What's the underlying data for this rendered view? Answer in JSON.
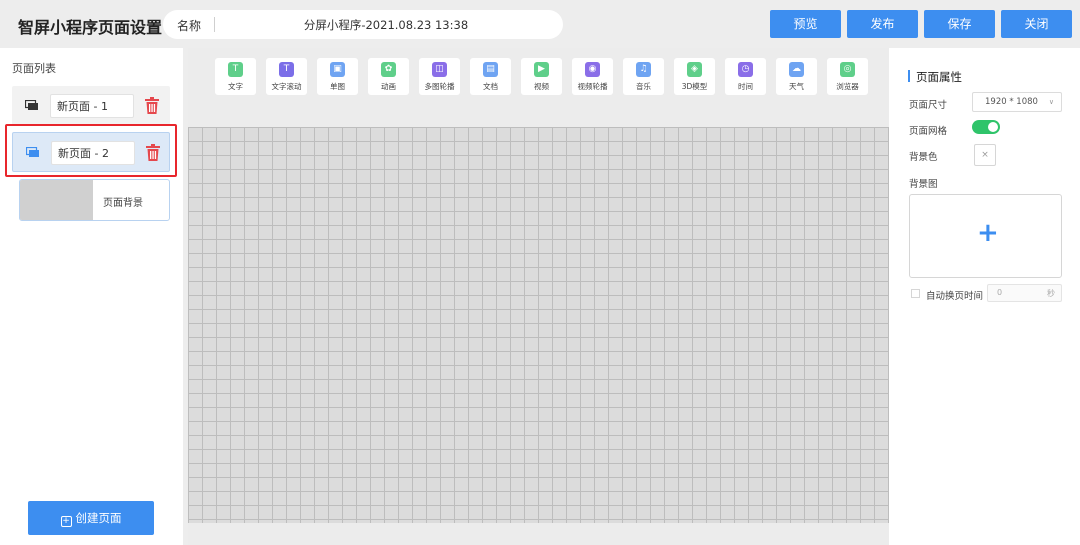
{
  "header": {
    "app_title": "智屏小程序页面设置",
    "name_label": "名称",
    "name_value": "分屏小程序-2021.08.23 13:38",
    "buttons": {
      "preview": "预览",
      "publish": "发布",
      "save": "保存",
      "close": "关闭"
    },
    "accent_color": "#3d8ef0"
  },
  "left_panel": {
    "title": "页面列表",
    "pages": [
      {
        "name": "新页面 - 1",
        "icon": "screen-icon",
        "delete_icon": "trash-icon"
      },
      {
        "name": "新页面 - 2",
        "icon": "screen-icon",
        "delete_icon": "trash-icon",
        "selected": true
      }
    ],
    "background_item_label": "页面背景",
    "create_button": "创建页面"
  },
  "toolbar": {
    "tools": [
      {
        "label": "文字",
        "icon": "T",
        "color": "#5fcf8a"
      },
      {
        "label": "文字滚动",
        "icon": "T",
        "color": "#7b6ee8"
      },
      {
        "label": "单图",
        "icon": "▣",
        "color": "#6fa4f2"
      },
      {
        "label": "动画",
        "icon": "✿",
        "color": "#5fcf8a"
      },
      {
        "label": "多图轮播",
        "icon": "◫",
        "color": "#8a6ee8"
      },
      {
        "label": "文档",
        "icon": "▤",
        "color": "#6fa4f2"
      },
      {
        "label": "视频",
        "icon": "▶",
        "color": "#5fcf8a"
      },
      {
        "label": "视频轮播",
        "icon": "◉",
        "color": "#8a6ee8"
      },
      {
        "label": "音乐",
        "icon": "♫",
        "color": "#6fa4f2"
      },
      {
        "label": "3D模型",
        "icon": "◈",
        "color": "#5fcf8a"
      },
      {
        "label": "时间",
        "icon": "◷",
        "color": "#8a6ee8"
      },
      {
        "label": "天气",
        "icon": "☁",
        "color": "#6fa4f2"
      },
      {
        "label": "浏览器",
        "icon": "◎",
        "color": "#5fcf8a"
      }
    ]
  },
  "right_panel": {
    "title": "页面属性",
    "size_label": "页面尺寸",
    "size_value": "1920 * 1080",
    "grid_label": "页面网格",
    "grid_enabled": true,
    "bg_color_label": "背景色",
    "bg_color_value": "×",
    "bg_image_label": "背景图",
    "upload_plus": "+",
    "auto_switch_label": "自动换页时间",
    "auto_switch_value": "0",
    "auto_switch_unit": "秒"
  }
}
